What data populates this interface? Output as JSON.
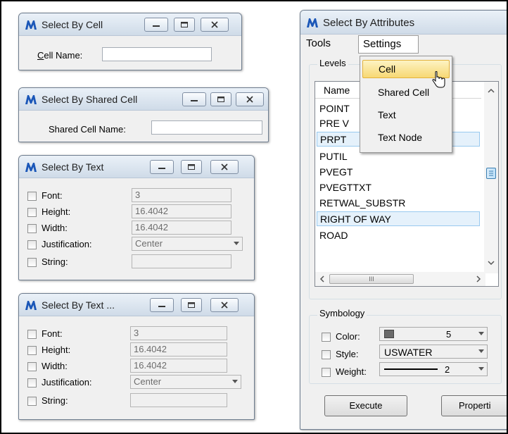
{
  "cell_dialog": {
    "title": "Select By Cell",
    "cell_name_label": "Cell Name:",
    "cell_name_value": ""
  },
  "shared_dialog": {
    "title": "Select By Shared Cell",
    "shared_name_label": "Shared Cell Name:",
    "shared_name_value": ""
  },
  "text_dialog_1": {
    "title": "Select By Text",
    "font_label": "Font:",
    "font_value": "3",
    "height_label": "Height:",
    "height_value": "16.4042",
    "width_label": "Width:",
    "width_value": "16.4042",
    "justification_label": "Justification:",
    "justification_value": "Center",
    "string_label": "String:",
    "string_value": ""
  },
  "text_dialog_2": {
    "title": "Select By Text ...",
    "font_label": "Font:",
    "font_value": "3",
    "height_label": "Height:",
    "height_value": "16.4042",
    "width_label": "Width:",
    "width_value": "16.4042",
    "justification_label": "Justification:",
    "justification_value": "Center",
    "string_label": "String:",
    "string_value": ""
  },
  "attributes_dialog": {
    "title": "Select By Attributes",
    "menu": {
      "tools": "Tools",
      "settings": "Settings"
    },
    "settings_menu": [
      "Cell",
      "Shared Cell",
      "Text",
      "Text Node"
    ],
    "levels_caption": "Levels",
    "levels_column": "Name",
    "levels": [
      "POINT",
      "PRE V",
      "PRPT",
      "PUTIL",
      "PVEGT",
      "PVEGTTXT",
      "RETWAL_SUBSTR",
      "RIGHT OF WAY",
      "ROAD"
    ],
    "hscroll_grip": "III",
    "symbology_caption": "Symbology",
    "color_label": "Color:",
    "color_value": "5",
    "color_swatch": "#6b6b6b",
    "style_label": "Style:",
    "style_value": "USWATER",
    "weight_label": "Weight:",
    "weight_value": "2",
    "execute_button": "Execute",
    "properties_button": "Properti"
  },
  "icons": {
    "app": "microstation-icon",
    "cursor": "mouse-pointer-icon"
  }
}
